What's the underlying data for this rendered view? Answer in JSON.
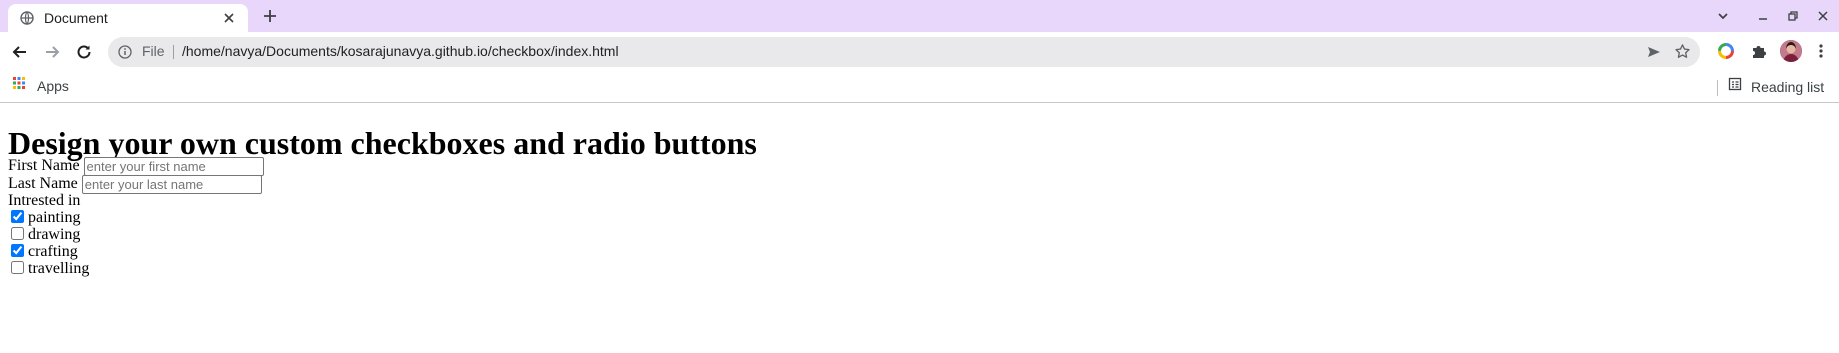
{
  "browser": {
    "tab_title": "Document",
    "omnibox": {
      "scheme": "File",
      "url": "/home/navya/Documents/kosarajunavya.github.io/checkbox/index.html"
    },
    "bookmarks": {
      "apps_label": "Apps",
      "reading_list_label": "Reading list"
    },
    "icons": [
      "globe-icon",
      "close-icon",
      "plus-icon",
      "chevron-down-icon",
      "minimize-icon",
      "restore-icon",
      "back-arrow-icon",
      "forward-arrow-icon",
      "reload-icon",
      "info-icon",
      "send-icon",
      "star-icon",
      "color-ring-icon",
      "puzzle-icon",
      "avatar",
      "more-vert-icon",
      "apps-grid-icon",
      "reading-list-icon"
    ],
    "colors": {
      "tabstrip": "#e8d7fa",
      "omnibox": "#e9e9eb",
      "checkbox_accent": "#0075ff"
    }
  },
  "page": {
    "heading": "Design your own custom checkboxes and radio buttons",
    "first_name": {
      "label": "First Name",
      "value": "",
      "placeholder": "enter your first name"
    },
    "last_name": {
      "label": "Last Name",
      "value": "",
      "placeholder": "enter your last name"
    },
    "interests_label": "Intrested in",
    "interests": [
      {
        "label": "painting",
        "checked": true
      },
      {
        "label": "drawing",
        "checked": false
      },
      {
        "label": "crafting",
        "checked": true
      },
      {
        "label": "travelling",
        "checked": false
      }
    ]
  }
}
